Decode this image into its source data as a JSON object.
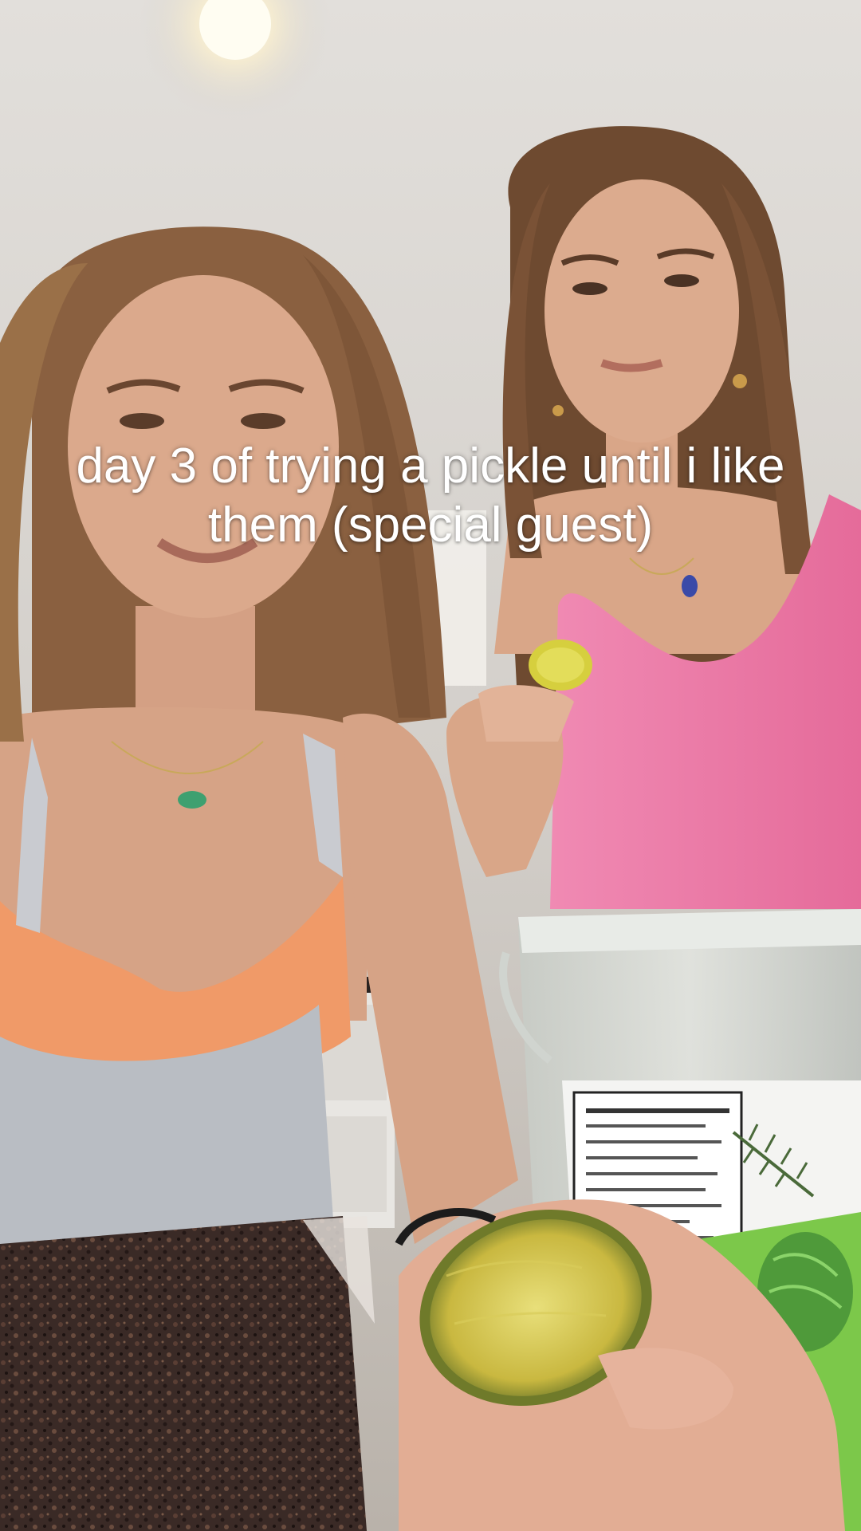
{
  "caption": "day 3 of trying a pickle until i like them (special guest)",
  "colors": {
    "wall": "#d8d4cf",
    "ceiling_light": "#fff6d8",
    "skin": "#d9a688",
    "hair_left": "#8a6040",
    "hair_right": "#6e4a30",
    "pink_top": "#ee7aa6",
    "orange_top": "#f09a68",
    "gray_shorts": "#b9bdc3",
    "countertop": "#3a2a26",
    "pickle": "#c9b840",
    "tub_label_green": "#7cc84a"
  },
  "objects": [
    "woman-left",
    "woman-right",
    "pickle-slice-held-up",
    "small-pickle-piece",
    "pickle-tub",
    "granite-countertop",
    "ceiling-light"
  ]
}
